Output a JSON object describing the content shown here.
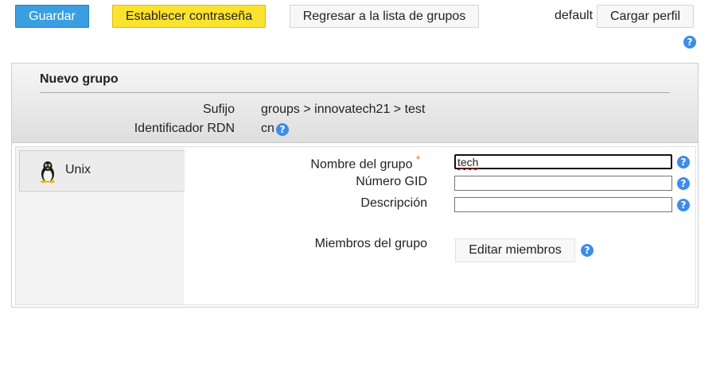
{
  "toolbar": {
    "save_label": "Guardar",
    "set_password_label": "Establecer contraseña",
    "back_label": "Regresar a la lista de grupos",
    "profile_name": "default",
    "load_profile_label": "Cargar perfil"
  },
  "header": {
    "title": "Nuevo grupo",
    "suffix_label": "Sufijo",
    "suffix_value": "groups > innovatech21 > test",
    "rdn_label": "Identificador RDN",
    "rdn_value": "cn"
  },
  "tabs": [
    {
      "label": "Unix",
      "icon": "tux-icon"
    }
  ],
  "form": {
    "group_name_label": "Nombre del grupo",
    "required_mark": "*",
    "group_name_value": "tech",
    "gid_label": "Número GID",
    "gid_value": "",
    "description_label": "Descripción",
    "description_value": "",
    "members_label": "Miembros del grupo",
    "edit_members_label": "Editar miembros"
  },
  "help_glyph": "?",
  "colors": {
    "save_button": "#3a9fe0",
    "password_button": "#fbe22f",
    "help_icon": "#3d8de8",
    "required_mark": "#e07020"
  }
}
